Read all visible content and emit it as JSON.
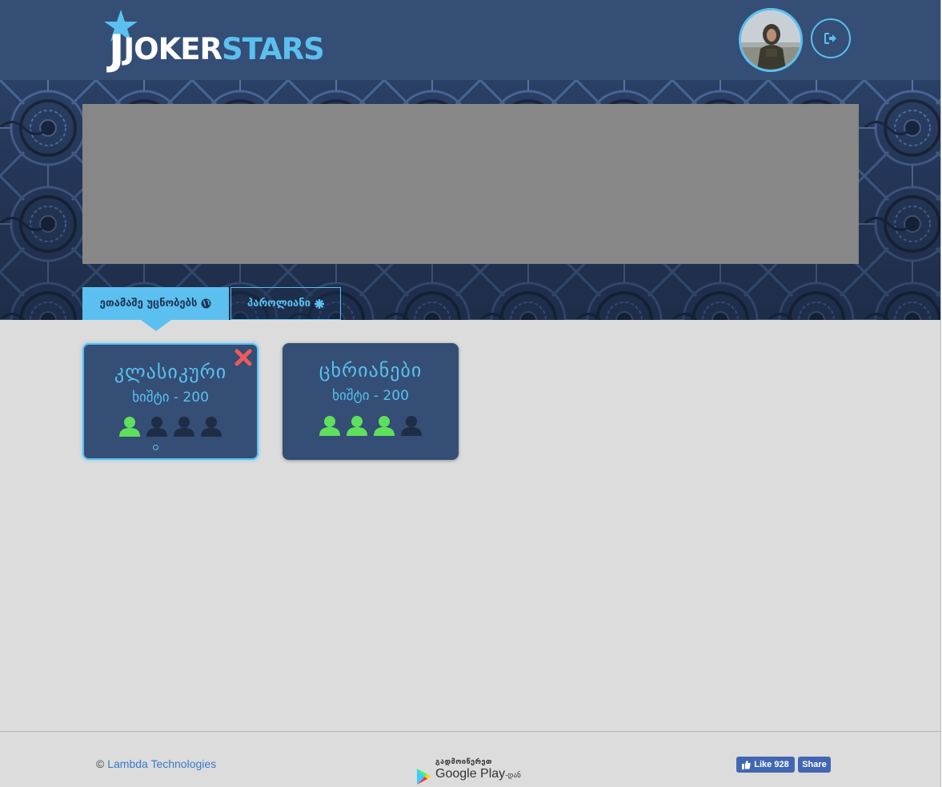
{
  "header": {
    "logo": {
      "joker": "JOKER",
      "stars": "STARS",
      "j": "J"
    },
    "avatar_alt": "user avatar"
  },
  "tabs": [
    {
      "label": "ეთამაშე უცნობებს",
      "icon": "globe-icon",
      "active": true
    },
    {
      "label": "პაროლიანი",
      "icon": "asterisk-icon",
      "active": false
    }
  ],
  "tables": [
    {
      "title": "კლასიკური",
      "bet": "ხიშტი - 200",
      "players_filled": 1,
      "players_total": 4,
      "selected": true
    },
    {
      "title": "ცხრიანები",
      "bet": "ხიშტი - 200",
      "players_filled": 3,
      "players_total": 4,
      "selected": false
    }
  ],
  "footer": {
    "copyright_symbol": "©",
    "company": "Lambda Technologies",
    "gplay_top": "გადმოიწერეთ",
    "gplay_main": "Google Play",
    "gplay_suffix": "-დან",
    "fb_like": "Like 928",
    "fb_share": "Share"
  },
  "colors": {
    "header_bg": "#344e75",
    "accent": "#5bc0f0",
    "player_filled": "#5fe05c",
    "player_empty": "#1e2c45",
    "close": "#f0595c"
  }
}
